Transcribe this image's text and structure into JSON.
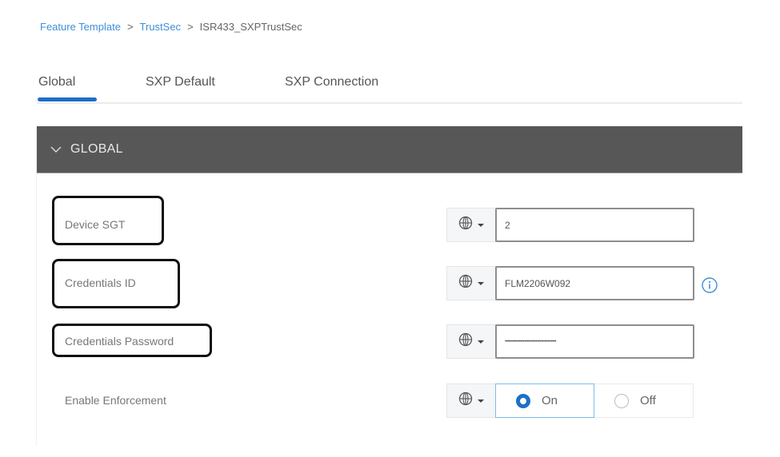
{
  "breadcrumb": {
    "items": [
      "Feature Template",
      "TrustSec",
      "ISR433_SXPTrustSec"
    ],
    "separator": ">"
  },
  "tabs": [
    {
      "label": "Global",
      "active": true
    },
    {
      "label": "SXP Default",
      "active": false
    },
    {
      "label": "SXP Connection",
      "active": false
    }
  ],
  "section": {
    "title": "GLOBAL",
    "expanded": true
  },
  "fields": {
    "device_sgt": {
      "label": "Device SGT",
      "value": "2",
      "scope_icon": "globe-icon"
    },
    "credentials_id": {
      "label": "Credentials ID",
      "value": "FLM2206W092",
      "scope_icon": "globe-icon",
      "info_icon": "info-icon"
    },
    "credentials_password": {
      "label": "Credentials Password",
      "value": "••••••••••••••••••••••••••••••••••••••••",
      "scope_icon": "globe-icon"
    },
    "enable_enforcement": {
      "label": "Enable Enforcement",
      "options": [
        "On",
        "Off"
      ],
      "selected": "On",
      "scope_icon": "globe-icon"
    }
  },
  "colors": {
    "accent": "#1d6fc7",
    "link": "#3f8fd8",
    "header_bg": "#575757",
    "annotation_border": "#111111"
  }
}
